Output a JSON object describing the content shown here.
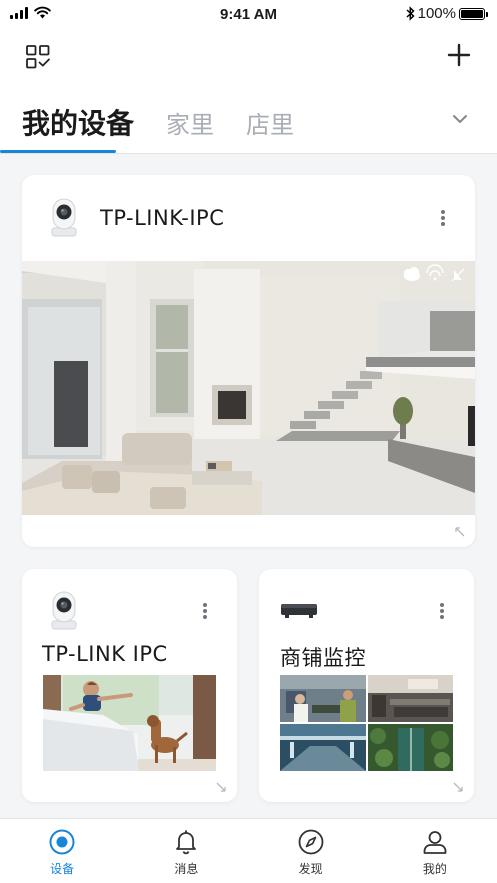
{
  "status_bar": {
    "time": "9:41 AM",
    "battery": "100%",
    "battery_level": 1.0
  },
  "header": {
    "tabs": [
      {
        "label": "我的设备",
        "active": true
      },
      {
        "label": "家里",
        "active": false
      },
      {
        "label": "店里",
        "active": false
      }
    ]
  },
  "devices": {
    "main": {
      "name": "TP-LINK-IPC"
    },
    "small1": {
      "name": "TP-LINK IPC"
    },
    "small2": {
      "name": "商铺监控"
    }
  },
  "bottom_nav": {
    "items": [
      {
        "label": "设备",
        "icon": "device-icon",
        "active": true
      },
      {
        "label": "消息",
        "icon": "bell-icon",
        "active": false
      },
      {
        "label": "发现",
        "icon": "compass-icon",
        "active": false
      },
      {
        "label": "我的",
        "icon": "user-icon",
        "active": false
      }
    ]
  },
  "colors": {
    "accent": "#1a86d8",
    "inactive_tab": "#a9adb5",
    "background": "#f4f5f7"
  }
}
